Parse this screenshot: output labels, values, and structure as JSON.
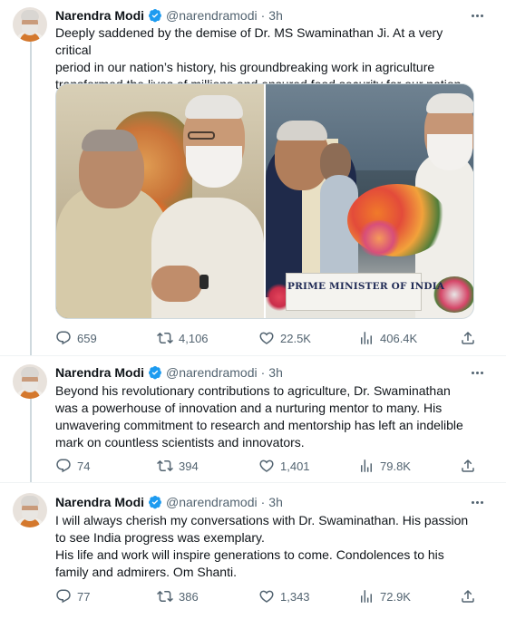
{
  "tweets": [
    {
      "author_name": "Narendra Modi",
      "handle": "@narendramodi",
      "separator": "·",
      "time": "3h",
      "text_lines": [
        "Deeply saddened by the demise of Dr. MS Swaminathan Ji. At a very critical",
        "period in our nation’s history, his groundbreaking work in agriculture",
        "transformed the lives of millions and ensured food security for our nation."
      ],
      "media_sign_text": "PRIME MINISTER OF INDIA",
      "stats": {
        "replies": "659",
        "retweets": "4,106",
        "likes": "22.5K",
        "views": "406.4K"
      }
    },
    {
      "author_name": "Narendra Modi",
      "handle": "@narendramodi",
      "separator": "·",
      "time": "3h",
      "text_lines": [
        "Beyond his revolutionary contributions to agriculture, Dr. Swaminathan",
        "was a powerhouse of innovation and a nurturing mentor to many. His",
        "unwavering commitment to research and mentorship has left an indelible",
        "mark on countless scientists and innovators."
      ],
      "stats": {
        "replies": "74",
        "retweets": "394",
        "likes": "1,401",
        "views": "79.8K"
      }
    },
    {
      "author_name": "Narendra Modi",
      "handle": "@narendramodi",
      "separator": "·",
      "time": "3h",
      "text_lines": [
        "I will always cherish my conversations with Dr. Swaminathan. His passion",
        "to see India progress was exemplary.",
        "His life and work will inspire generations to come. Condolences to his",
        "family and admirers. Om Shanti."
      ],
      "stats": {
        "replies": "77",
        "retweets": "386",
        "likes": "1,343",
        "views": "72.9K"
      }
    }
  ],
  "icons": {
    "verified": "verified-badge-icon",
    "more": "more-options-icon",
    "reply": "reply-icon",
    "retweet": "retweet-icon",
    "like": "heart-icon",
    "views": "views-icon",
    "share": "share-icon"
  },
  "colors": {
    "text_primary": "#0f1419",
    "text_secondary": "#536471",
    "verified_blue": "#1d9bf0",
    "thread_line": "#cfd9de"
  }
}
